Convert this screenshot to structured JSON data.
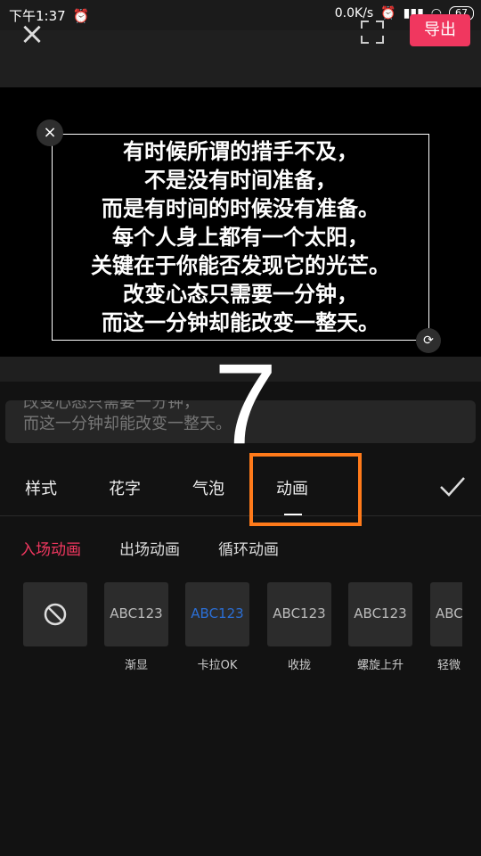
{
  "status_bar": {
    "time": "下午1:37",
    "net_speed": "0.0K/s",
    "battery": "67"
  },
  "top_bar": {
    "export_label": "导出"
  },
  "preview": {
    "lines": [
      "有时候所谓的措手不及，",
      "不是没有时间准备，",
      "而是有时间的时候没有准备。",
      "每个人身上都有一个太阳，",
      "关键在于你能否发现它的光芒。",
      "改变心态只需要一分钟，",
      "而这一分钟却能改变一整天。"
    ]
  },
  "input": {
    "line1": "改变心态只需要一分钟，",
    "line2": "而这一分钟却能改变一整天。"
  },
  "overlay_number": "7",
  "tabs": [
    {
      "label": "样式"
    },
    {
      "label": "花字"
    },
    {
      "label": "气泡"
    },
    {
      "label": "动画"
    }
  ],
  "subtabs": [
    {
      "label": "入场动画"
    },
    {
      "label": "出场动画"
    },
    {
      "label": "循环动画"
    }
  ],
  "animations": [
    {
      "text": "ABC123",
      "label": "渐显"
    },
    {
      "text": "ABC123",
      "label": "卡拉OK"
    },
    {
      "text": "ABC123",
      "label": "收拢"
    },
    {
      "text": "ABC123",
      "label": "螺旋上升"
    },
    {
      "text": "ABC",
      "label": "轻微"
    }
  ],
  "colors": {
    "accent": "#f0375f",
    "highlight": "#ff7a1a",
    "karaoke_blue": "#2b6fd6"
  }
}
